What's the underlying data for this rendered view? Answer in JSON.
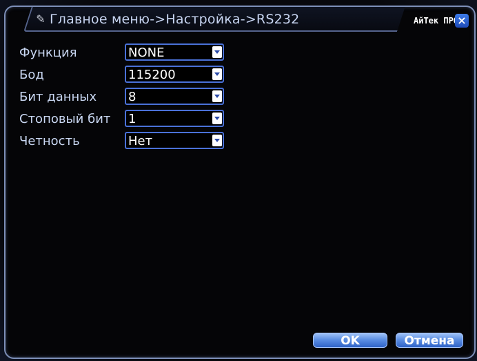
{
  "window": {
    "title": "Главное меню->Настройка->RS232",
    "brand": "АйТек ПРО",
    "close_icon": "close-icon",
    "title_icon": "wrench-icon"
  },
  "form": {
    "rows": [
      {
        "label": "Функция",
        "value": "NONE"
      },
      {
        "label": "Бод",
        "value": "115200"
      },
      {
        "label": "Бит данных",
        "value": "8"
      },
      {
        "label": "Стоповый бит",
        "value": "1"
      },
      {
        "label": "Четность",
        "value": "Нет"
      }
    ]
  },
  "buttons": {
    "ok": "OK",
    "cancel": "Отмена"
  },
  "colors": {
    "accent": "#4a71d8",
    "label_text": "#c9d7f2",
    "button": "#5c8fe3"
  }
}
